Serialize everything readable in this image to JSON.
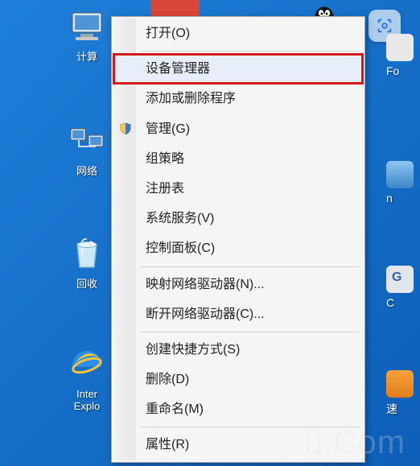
{
  "desktop": {
    "computer_label": "计算",
    "network_label": "网络",
    "recycle_label": "回收",
    "ie_label_line1": "Inter",
    "ie_label_line2": "Explo"
  },
  "context_menu": {
    "open": "打开(O)",
    "device_manager": "设备管理器",
    "add_remove_programs": "添加或删除程序",
    "manage": "管理(G)",
    "group_policy": "组策略",
    "registry": "注册表",
    "system_services": "系统服务(V)",
    "control_panel": "控制面板(C)",
    "map_drive": "映射网络驱动器(N)...",
    "disconnect_drive": "断开网络驱动器(C)...",
    "create_shortcut": "创建快捷方式(S)",
    "delete": "删除(D)",
    "rename": "重命名(M)",
    "properties": "属性(R)"
  },
  "right_icons": {
    "label1": "Fo",
    "label2": "n",
    "label3": "C",
    "label4": "速"
  },
  "watermark": "u.Com"
}
